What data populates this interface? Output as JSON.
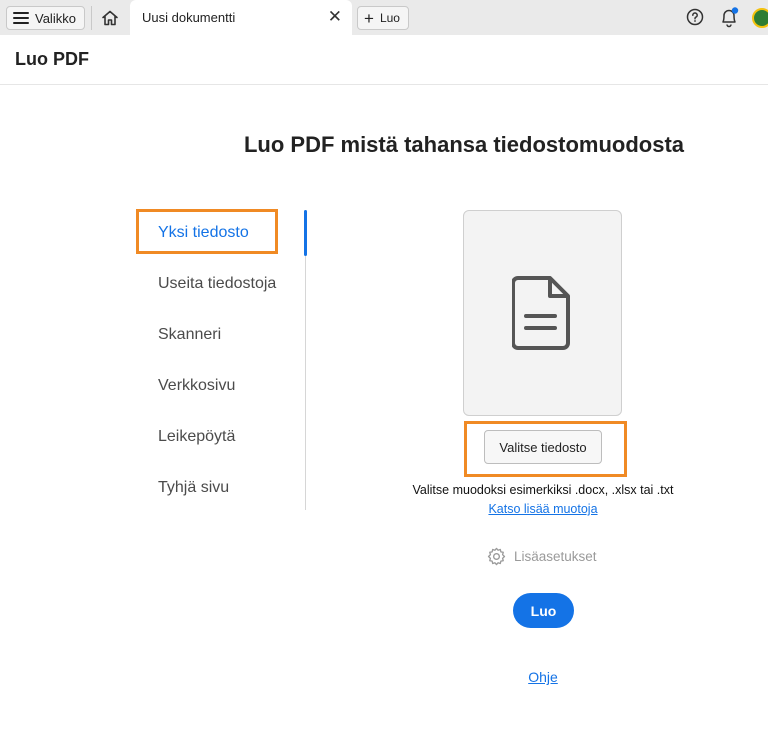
{
  "topbar": {
    "menu_label": "Valikko",
    "tab_title": "Uusi dokumentti",
    "new_label": "Luo"
  },
  "page": {
    "title": "Luo PDF",
    "heading": "Luo PDF mistä tahansa tiedostomuodosta"
  },
  "options": [
    {
      "label": "Yksi tiedosto",
      "selected": true
    },
    {
      "label": "Useita tiedostoja",
      "selected": false
    },
    {
      "label": "Skanneri",
      "selected": false
    },
    {
      "label": "Verkkosivu",
      "selected": false
    },
    {
      "label": "Leikepöytä",
      "selected": false
    },
    {
      "label": "Tyhjä sivu",
      "selected": false
    }
  ],
  "file_area": {
    "icon": "document-icon",
    "choose_button": "Valitse tiedosto",
    "hint": "Valitse muodoksi esimerkiksi .docx, .xlsx tai .txt",
    "more_link": "Katso lisää muotoja"
  },
  "settings_label": "Lisäasetukset",
  "create_button": "Luo",
  "help_link": "Ohje",
  "colors": {
    "accent": "#1473e6",
    "highlight": "#f08a24"
  }
}
